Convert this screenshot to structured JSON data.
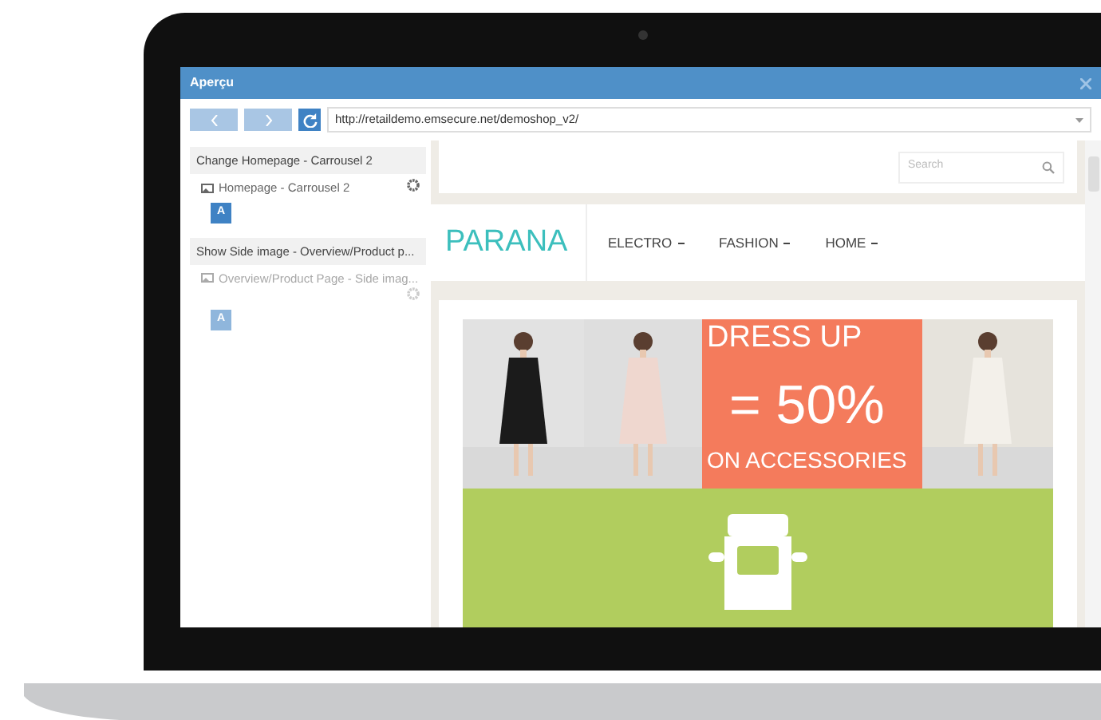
{
  "window": {
    "title": "Aperçu"
  },
  "toolbar": {
    "url": "http://retaildemo.emsecure.net/demoshop_v2/"
  },
  "sidebar": {
    "groups": [
      {
        "title": "Change Homepage - Carrousel 2",
        "item": {
          "label": "Homepage - Carrousel 2",
          "disabled": false
        },
        "badge": "A"
      },
      {
        "title": "Show Side image - Overview/Product p...",
        "item": {
          "label": "Overview/Product Page - Side imag...",
          "disabled": true
        },
        "badge": "A"
      }
    ]
  },
  "shop": {
    "search": {
      "placeholder": "Search"
    },
    "logo": "PARANA",
    "nav": [
      {
        "label": "ELECTRO"
      },
      {
        "label": "FASHION"
      },
      {
        "label": "HOME"
      }
    ],
    "banner": {
      "promo": [
        "DRESS UP",
        "= 50%",
        "ON ACCESSORIES"
      ]
    }
  }
}
